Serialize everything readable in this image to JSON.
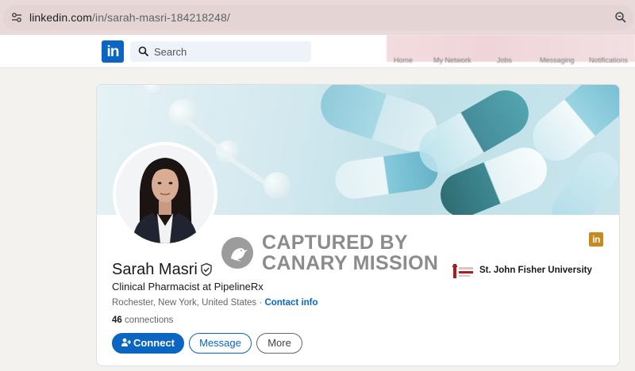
{
  "browser": {
    "url_host": "linkedin.com",
    "url_path": "/in/sarah-masri-184218248/",
    "site_icon": "tune-icon",
    "zoom_icon": "zoom-icon"
  },
  "nav": {
    "logo_text": "in",
    "search_placeholder": "Search",
    "items": [
      {
        "label": "Home"
      },
      {
        "label": "My Network"
      },
      {
        "label": "Jobs"
      },
      {
        "label": "Messaging"
      },
      {
        "label": "Notifications"
      }
    ]
  },
  "profile": {
    "name": "Sarah Masri",
    "headline": "Clinical Pharmacist at PipelineRx",
    "location": "Rochester, New York, United States",
    "separator": "·",
    "contact_info": "Contact info",
    "connections_count": "46",
    "connections_label": "connections",
    "education": "St. John Fisher University",
    "li_badge": "in",
    "buttons": {
      "connect": "Connect",
      "message": "Message",
      "more": "More"
    }
  },
  "watermark": {
    "line1": "CAPTURED BY",
    "line2": "CANARY MISSION"
  },
  "colors": {
    "linkedin_blue": "#0a66c2",
    "watermark_gray": "#8c8c8c",
    "badge_gold": "#c98a1d"
  }
}
